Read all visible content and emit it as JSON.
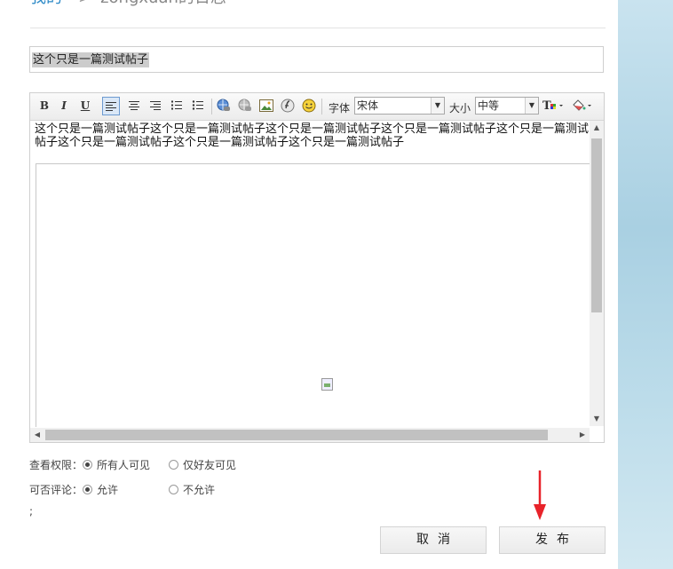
{
  "breadcrumb": {
    "link": "我的",
    "separator": ">",
    "current": "zongxuan的日志"
  },
  "title_field": {
    "value": "这个只是一篇测试帖子"
  },
  "toolbar": {
    "bold": "B",
    "italic": "I",
    "underline": "U",
    "font_label": "字体",
    "font_value": "宋体",
    "size_label": "大小",
    "size_value": "中等"
  },
  "editor": {
    "content": "这个只是一篇测试帖子这个只是一篇测试帖子这个只是一篇测试帖子这个只是一篇测试帖子这个只是一篇测试帖子这个只是一篇测试帖子这个只是一篇测试帖子这个只是一篇测试帖子"
  },
  "permissions": {
    "view_label": "查看权限：",
    "view_options": [
      "所有人可见",
      "仅好友可见"
    ],
    "view_selected": 0,
    "comment_label": "可否评论：",
    "comment_options": [
      "允许",
      "不允许"
    ],
    "comment_selected": 0,
    "misc": ";"
  },
  "buttons": {
    "cancel": "取消",
    "publish": "发布"
  },
  "colors": {
    "accent_link": "#2d8ac7",
    "annotation_arrow": "#e8232a"
  }
}
